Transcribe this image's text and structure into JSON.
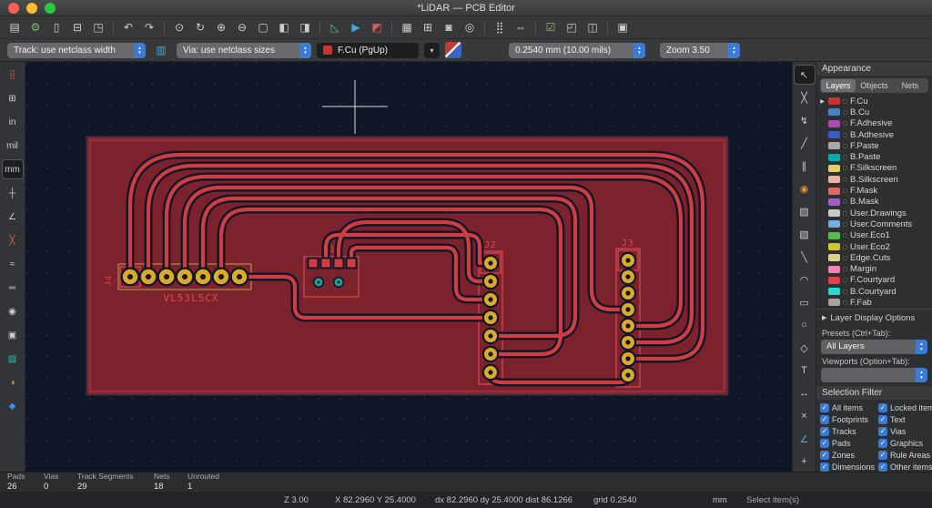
{
  "theme": {
    "canvas-bg": "#0f1626",
    "grid-dot": "#2c3a55",
    "zone": "#7c222c",
    "zone-border": "#92303c",
    "track": "#cf3d42",
    "pad": "#dcaa2a",
    "hole": "#0f1626",
    "tealpad": "#1fa396",
    "silk": "#d84b50",
    "accent": "#3a7bd7",
    "toolbar": "#37383a",
    "panel": "#2e2f31",
    "panel-header": "#3a3b3d",
    "statusbar": "#2c2d2f",
    "bottombar": "#232427",
    "text": "#d6d8da"
  },
  "window": {
    "title": "*LiDAR — PCB Editor"
  },
  "toolbar_main": [
    {
      "name": "save-button",
      "glyph": "▤"
    },
    {
      "name": "board-setup-button",
      "glyph": "⚙",
      "color": "#7bc062"
    },
    {
      "name": "page-settings-button",
      "glyph": "▯"
    },
    {
      "name": "print-button",
      "glyph": "⊟"
    },
    {
      "name": "plot-button",
      "glyph": "◳"
    },
    {
      "name": "separator",
      "sep": true,
      "glyph": ""
    },
    {
      "name": "undo-button",
      "glyph": "↶"
    },
    {
      "name": "redo-button",
      "glyph": "↷"
    },
    {
      "name": "separator",
      "sep": true,
      "glyph": ""
    },
    {
      "name": "find-button",
      "glyph": "⊙"
    },
    {
      "name": "refresh-view-button",
      "glyph": "↻"
    },
    {
      "name": "zoom-in-button",
      "glyph": "⊕"
    },
    {
      "name": "zoom-out-button",
      "glyph": "⊖"
    },
    {
      "name": "zoom-fit-button",
      "glyph": "▢"
    },
    {
      "name": "zoom-to-selection-button",
      "glyph": "◧"
    },
    {
      "name": "zoom-to-objects-button",
      "glyph": "◨"
    },
    {
      "name": "separator",
      "sep": true,
      "glyph": ""
    },
    {
      "name": "show-ratsnest-button",
      "glyph": "◺",
      "color": "#45b8a8"
    },
    {
      "name": "route-tracks-mode-button",
      "glyph": "▶",
      "color": "#4aa3e0"
    },
    {
      "name": "high-contrast-mode-button",
      "glyph": "◩",
      "color": "#d06060"
    },
    {
      "name": "separator",
      "sep": true,
      "glyph": ""
    },
    {
      "name": "footprint-properties-button",
      "glyph": "▦"
    },
    {
      "name": "align-tools-button",
      "glyph": "⊞"
    },
    {
      "name": "lock-button",
      "glyph": "◙"
    },
    {
      "name": "unlock-button",
      "glyph": "◎"
    },
    {
      "name": "separator",
      "sep": true,
      "glyph": ""
    },
    {
      "name": "array-button",
      "glyph": "⣿"
    },
    {
      "name": "measure-button",
      "glyph": "⇔"
    },
    {
      "name": "separator",
      "sep": true,
      "glyph": ""
    },
    {
      "name": "drc-button",
      "glyph": "☑",
      "color": "#8ac850"
    },
    {
      "name": "footprint-editor-button",
      "glyph": "◰"
    },
    {
      "name": "3d-viewer-button",
      "glyph": "◫"
    },
    {
      "name": "separator",
      "sep": true,
      "glyph": ""
    },
    {
      "name": "scripting-console-button",
      "glyph": "▣"
    }
  ],
  "toolbar_controls": {
    "track_width": "Track: use netclass width",
    "edit_sizes_glyph": "▥",
    "via_size": "Via: use netclass sizes",
    "active_layer": "F.Cu (PgUp)",
    "layer_swatch": "#c83434",
    "grid": "0.2540 mm (10.00 mils)",
    "zoom": "Zoom 3.50",
    "dropdown_glyph": "▾"
  },
  "left_toolbar": [
    {
      "name": "toggle-grid-icon",
      "glyph": "⣿",
      "color": "#c05555"
    },
    {
      "name": "grid-settings-icon",
      "glyph": "⊞"
    },
    {
      "name": "units-inches-button",
      "glyph": "in"
    },
    {
      "name": "units-mils-button",
      "glyph": "mil"
    },
    {
      "name": "units-mm-button",
      "glyph": "mm",
      "active": true
    },
    {
      "name": "cursor-shape-icon",
      "glyph": "┼"
    },
    {
      "name": "polar-coordinates-icon",
      "glyph": "∠"
    },
    {
      "name": "ratsnest-visibility-icon",
      "glyph": "╳",
      "color": "#cf6b4a"
    },
    {
      "name": "curved-ratsnest-icon",
      "glyph": "≈"
    },
    {
      "name": "track-display-mode-icon",
      "glyph": "═"
    },
    {
      "name": "via-display-mode-icon",
      "glyph": "◉"
    },
    {
      "name": "pad-display-mode-icon",
      "glyph": "▣"
    },
    {
      "name": "zone-display-mode-icon",
      "glyph": "▨",
      "color": "#45b8a8"
    },
    {
      "name": "inactive-layer-dim-icon",
      "glyph": "◑",
      "color": "#d8a030"
    },
    {
      "name": "appearance-manager-icon",
      "glyph": "◆",
      "color": "#3f8fe0"
    }
  ],
  "right_toolbar": [
    {
      "name": "select-tool",
      "glyph": "↖",
      "active": true
    },
    {
      "name": "local-ratsnest-tool",
      "glyph": "╳"
    },
    {
      "name": "highlight-net-tool",
      "glyph": "↯"
    },
    {
      "name": "route-single-track-tool",
      "glyph": "╱"
    },
    {
      "name": "route-differential-pair-tool",
      "glyph": "∥"
    },
    {
      "name": "add-via-tool",
      "glyph": "◉",
      "color": "#e09038"
    },
    {
      "name": "add-filled-zone-tool",
      "glyph": "▨"
    },
    {
      "name": "add-rule-area-tool",
      "glyph": "▧"
    },
    {
      "name": "draw-line-tool",
      "glyph": "╲"
    },
    {
      "name": "draw-arc-tool",
      "glyph": "◠"
    },
    {
      "name": "draw-rectangle-tool",
      "glyph": "▭"
    },
    {
      "name": "draw-circle-tool",
      "glyph": "○"
    },
    {
      "name": "draw-polygon-tool",
      "glyph": "◇"
    },
    {
      "name": "add-text-tool",
      "glyph": "T"
    },
    {
      "name": "add-dimension-tool",
      "glyph": "↔"
    },
    {
      "name": "delete-tool",
      "glyph": "×"
    },
    {
      "name": "measure-tool",
      "glyph": "∠",
      "color": "#45b8d8"
    },
    {
      "name": "drill-origin-tool",
      "glyph": "+"
    }
  ],
  "pcb": {
    "j4": "J4",
    "sensor": "VL53L5CX",
    "s1": "S1",
    "j2": "J2",
    "j3": "J3"
  },
  "appearance": {
    "title": "Appearance",
    "tabs": [
      {
        "name": "tab-layers",
        "label": "Layers",
        "active": true
      },
      {
        "name": "tab-objects",
        "label": "Objects"
      },
      {
        "name": "tab-nets",
        "label": "Nets"
      }
    ],
    "layers": [
      {
        "name": "layer-fcu",
        "label": "F.Cu",
        "color": "#c83434",
        "indicator": "▶",
        "active": true
      },
      {
        "name": "layer-bcu",
        "label": "B.Cu",
        "color": "#4d7fc4"
      },
      {
        "name": "layer-fadhesive",
        "label": "F.Adhesive",
        "color": "#af4bb0"
      },
      {
        "name": "layer-badhesive",
        "label": "B.Adhesive",
        "color": "#3c5ac8"
      },
      {
        "name": "layer-fpaste",
        "label": "F.Paste",
        "color": "#a8a8a8"
      },
      {
        "name": "layer-bpaste",
        "label": "B.Paste",
        "color": "#00adad"
      },
      {
        "name": "layer-fsilkscreen",
        "label": "F.Silkscreen",
        "color": "#ded06e"
      },
      {
        "name": "layer-bsilkscreen",
        "label": "B.Silkscreen",
        "color": "#e8b2a7"
      },
      {
        "name": "layer-fmask",
        "label": "F.Mask",
        "color": "#d96b66"
      },
      {
        "name": "layer-bmask",
        "label": "B.Mask",
        "color": "#9d5fc6"
      },
      {
        "name": "layer-userdrawings",
        "label": "User.Drawings",
        "color": "#c9c9c9"
      },
      {
        "name": "layer-usercomments",
        "label": "User.Comments",
        "color": "#76aede"
      },
      {
        "name": "layer-usereco1",
        "label": "User.Eco1",
        "color": "#53bf53"
      },
      {
        "name": "layer-usereco2",
        "label": "User.Eco2",
        "color": "#cfc62f"
      },
      {
        "name": "layer-edgecuts",
        "label": "Edge.Cuts",
        "color": "#d8d28a"
      },
      {
        "name": "layer-margin",
        "label": "Margin",
        "color": "#f283b7"
      },
      {
        "name": "layer-fcourtyard",
        "label": "F.Courtyard",
        "color": "#e0414b"
      },
      {
        "name": "layer-bcourtyard",
        "label": "B.Courtyard",
        "color": "#2bd8cc"
      },
      {
        "name": "layer-ffab",
        "label": "F.Fab",
        "color": "#a8a29b"
      }
    ],
    "layer_display_options": "Layer Display Options",
    "disclosure_icon": "▶",
    "presets_label": "Presets (Ctrl+Tab):",
    "presets_value": "All Layers",
    "viewports_label": "Viewports (Option+Tab):",
    "viewports_value": "",
    "selection_filter_title": "Selection Filter",
    "selection_filter_left": [
      {
        "name": "filter-all-items",
        "label": "All items",
        "active": true
      },
      {
        "name": "filter-footprints",
        "label": "Footprints",
        "active": true
      },
      {
        "name": "filter-tracks",
        "label": "Tracks",
        "active": true
      },
      {
        "name": "filter-pads",
        "label": "Pads",
        "active": true
      },
      {
        "name": "filter-zones",
        "label": "Zones",
        "active": true
      },
      {
        "name": "filter-dimensions",
        "label": "Dimensions",
        "active": true
      }
    ],
    "selection_filter_right": [
      {
        "name": "filter-locked-items",
        "label": "Locked items",
        "active": true
      },
      {
        "name": "filter-text",
        "label": "Text",
        "active": true
      },
      {
        "name": "filter-vias",
        "label": "Vias",
        "active": true
      },
      {
        "name": "filter-graphics",
        "label": "Graphics",
        "active": true
      },
      {
        "name": "filter-rule-areas",
        "label": "Rule Areas",
        "active": true
      },
      {
        "name": "filter-other-items",
        "label": "Other items",
        "active": true
      }
    ]
  },
  "status": {
    "stats": [
      {
        "name": "stat-pads",
        "label": "Pads",
        "value": "26"
      },
      {
        "name": "stat-vias",
        "label": "Vias",
        "value": "0"
      },
      {
        "name": "stat-track-segments",
        "label": "Track Segments",
        "value": "29"
      },
      {
        "name": "stat-nets",
        "label": "Nets",
        "value": "18"
      },
      {
        "name": "stat-unrouted",
        "label": "Unrouted",
        "value": "1"
      }
    ],
    "bottom": {
      "zoom": "Z 3.00",
      "cursor": "X 82.2960 Y 25.4000",
      "delta": "dx 82.2960 dy 25.4000 dist 86.1266",
      "grid": "grid 0.2540",
      "units": "mm",
      "hint": "Select item(s)"
    }
  }
}
